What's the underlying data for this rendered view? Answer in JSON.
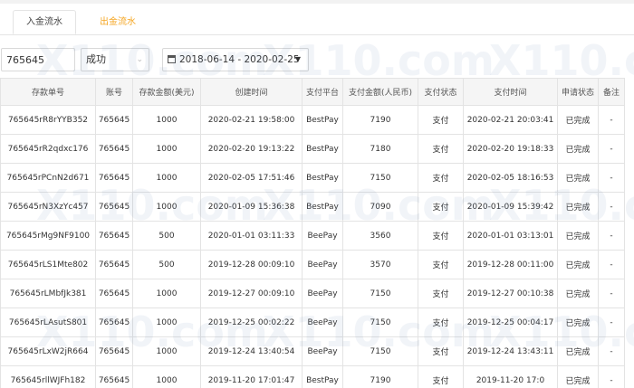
{
  "tabs": [
    {
      "label": "入金流水",
      "active": true
    },
    {
      "label": "出金流水",
      "active": false
    }
  ],
  "filters": {
    "account_value": "765645",
    "status_value": "成功",
    "date_range": "2018-06-14 - 2020-02-25"
  },
  "table": {
    "headers": [
      "存款单号",
      "账号",
      "存款金额(美元)",
      "创建时间",
      "支付平台",
      "支付金额(人民币)",
      "支付状态",
      "支付时间",
      "申请状态",
      "备注"
    ],
    "rows": [
      [
        "765645rR8rYYB352",
        "765645",
        "1000",
        "2020-02-21 19:58:00",
        "BestPay",
        "7190",
        "支付",
        "2020-02-21 20:03:41",
        "已完成",
        "-"
      ],
      [
        "765645rR2qdxc176",
        "765645",
        "1000",
        "2020-02-20 19:13:22",
        "BestPay",
        "7180",
        "支付",
        "2020-02-20 19:18:33",
        "已完成",
        "-"
      ],
      [
        "765645rPCnN2d671",
        "765645",
        "1000",
        "2020-02-05 17:51:46",
        "BestPay",
        "7150",
        "支付",
        "2020-02-05 18:16:53",
        "已完成",
        "-"
      ],
      [
        "765645rN3XzYc457",
        "765645",
        "1000",
        "2020-01-09 15:36:38",
        "BestPay",
        "7090",
        "支付",
        "2020-01-09 15:39:42",
        "已完成",
        "-"
      ],
      [
        "765645rMg9NF9100",
        "765645",
        "500",
        "2020-01-01 03:11:33",
        "BeePay",
        "3560",
        "支付",
        "2020-01-01 03:13:01",
        "已完成",
        "-"
      ],
      [
        "765645rLS1Mte802",
        "765645",
        "500",
        "2019-12-28 00:09:10",
        "BeePay",
        "3570",
        "支付",
        "2019-12-28 00:11:00",
        "已完成",
        "-"
      ],
      [
        "765645rLMbfJk381",
        "765645",
        "1000",
        "2019-12-27 00:09:10",
        "BeePay",
        "7150",
        "支付",
        "2019-12-27 00:10:38",
        "已完成",
        "-"
      ],
      [
        "765645rLAsutS801",
        "765645",
        "1000",
        "2019-12-25 00:02:22",
        "BeePay",
        "7150",
        "支付",
        "2019-12-25 00:04:17",
        "已完成",
        "-"
      ],
      [
        "765645rLxW2jR664",
        "765645",
        "1000",
        "2019-12-24 13:40:54",
        "BeePay",
        "7150",
        "支付",
        "2019-12-24 13:43:11",
        "已完成",
        "-"
      ],
      [
        "765645rllWJFh182",
        "765645",
        "1000",
        "2019-11-20 17:01:47",
        "BestPay",
        "7190",
        "支付",
        "2019-11-20 17:0",
        "已完成",
        "-"
      ]
    ]
  },
  "watermark": {
    "text": "X110.com"
  }
}
